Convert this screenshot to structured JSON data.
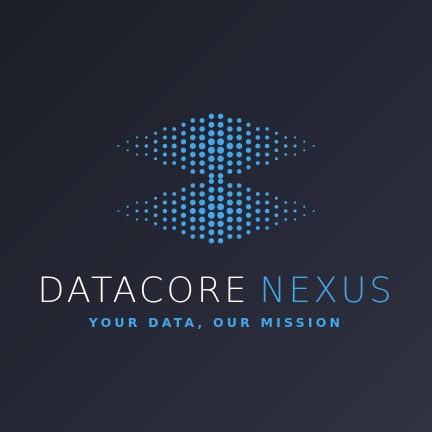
{
  "brand": {
    "name_part1": "DATACORE",
    "name_part2": "NEXUS",
    "tagline": "YOUR DATA, OUR MISSION"
  },
  "colors": {
    "background_dark": "#1c1e29",
    "background_light": "#303240",
    "accent": "#3fa7ea",
    "text_primary": "#ffffff"
  },
  "icon": "dotted-hourglass-logo-icon"
}
